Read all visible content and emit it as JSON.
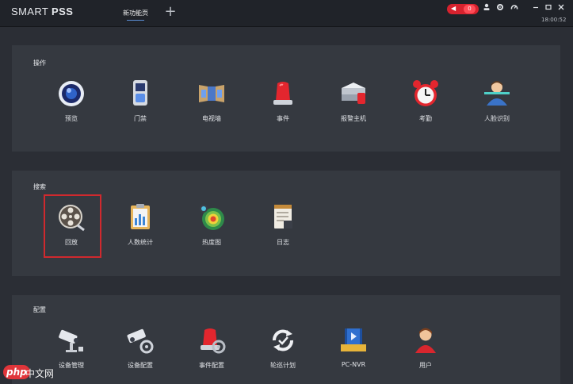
{
  "app": {
    "brand_part1": "SMART ",
    "brand_part2": "PSS"
  },
  "tabs": [
    {
      "label": "新功能页"
    }
  ],
  "titlebar": {
    "alarm_count": "0",
    "time": "18:00:52"
  },
  "sections": [
    {
      "title": "操作",
      "items": [
        {
          "label": "预览",
          "icon": "preview-icon"
        },
        {
          "label": "门禁",
          "icon": "access-control-icon"
        },
        {
          "label": "电视墙",
          "icon": "video-wall-icon"
        },
        {
          "label": "事件",
          "icon": "event-icon"
        },
        {
          "label": "报警主机",
          "icon": "alarm-host-icon"
        },
        {
          "label": "考勤",
          "icon": "attendance-icon"
        },
        {
          "label": "人脸识别",
          "icon": "face-recognition-icon"
        }
      ]
    },
    {
      "title": "搜索",
      "items": [
        {
          "label": "回放",
          "icon": "playback-icon"
        },
        {
          "label": "人数统计",
          "icon": "people-count-icon"
        },
        {
          "label": "热度图",
          "icon": "heatmap-icon"
        },
        {
          "label": "日志",
          "icon": "log-icon"
        }
      ]
    },
    {
      "title": "配置",
      "items": [
        {
          "label": "设备管理",
          "icon": "device-manager-icon"
        },
        {
          "label": "设备配置",
          "icon": "device-config-icon"
        },
        {
          "label": "事件配置",
          "icon": "event-config-icon"
        },
        {
          "label": "轮巡计划",
          "icon": "tour-plan-icon"
        },
        {
          "label": "PC-NVR",
          "icon": "pc-nvr-icon"
        },
        {
          "label": "用户",
          "icon": "user-icon"
        }
      ]
    }
  ],
  "watermark": {
    "logo": "php",
    "text": "中文网"
  }
}
